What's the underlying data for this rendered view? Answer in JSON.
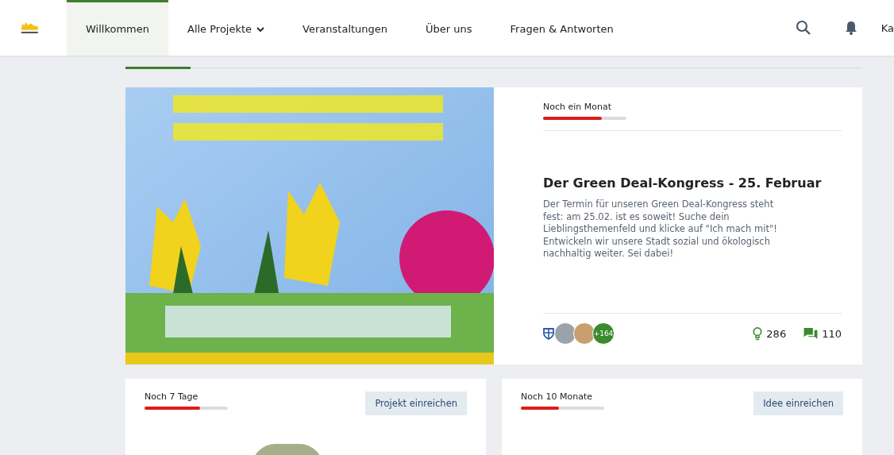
{
  "nav": {
    "items": [
      {
        "label": "Willkommen",
        "selected": true,
        "dropdown": false
      },
      {
        "label": "Alle Projekte",
        "selected": false,
        "dropdown": true
      },
      {
        "label": "Veranstaltungen",
        "selected": false,
        "dropdown": false
      },
      {
        "label": "Über uns",
        "selected": false,
        "dropdown": false
      },
      {
        "label": "Fragen & Antworten",
        "selected": false,
        "dropdown": false
      }
    ],
    "user": "Ka"
  },
  "featured": {
    "time_left": "Noch ein Monat",
    "level": 0.7,
    "title": "Der Green Deal-Kongress - 25. Februar",
    "description": "Der Termin für unseren Green Deal-Kongress steht fest: am 25.02. ist es soweit! Suche dein Lieblingsthemenfeld und klicke auf \"Ich mach mit\"! Entwickeln wir unsere Stadt sozial und ökologisch nachhaltig weiter. Sei dabei!",
    "participants_more": "+164",
    "ideas": "286",
    "comments": "110"
  },
  "cards": [
    {
      "time_left": "Noch 7 Tage",
      "level": 0.67,
      "button": "Projekt einreichen"
    },
    {
      "time_left": "Noch 10 Monate",
      "level": 0.46,
      "button": "Idee einreichen"
    }
  ]
}
